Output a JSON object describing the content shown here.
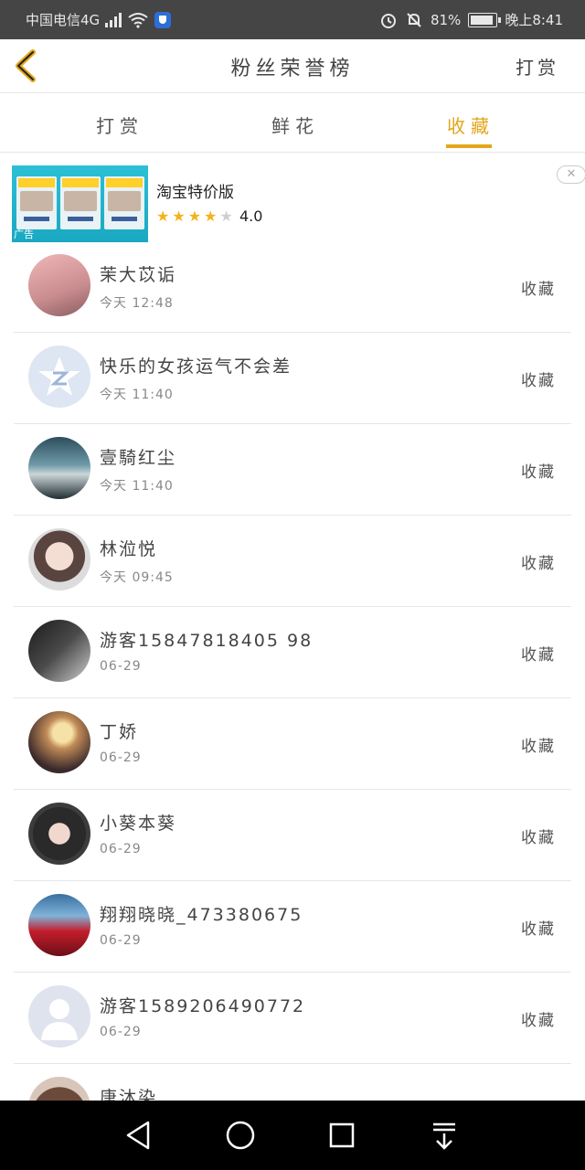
{
  "status_bar": {
    "carrier": "中国电信4G",
    "network": "4G",
    "battery_pct": "81%",
    "battery_fraction": 0.81,
    "time": "晚上8:41"
  },
  "header": {
    "title": "粉丝荣誉榜",
    "action_label": "打赏"
  },
  "tabs": [
    {
      "label": "打赏"
    },
    {
      "label": "鲜花"
    },
    {
      "label": "收藏",
      "active": true
    }
  ],
  "ad": {
    "title": "淘宝特价版",
    "rating": "4.0",
    "stars": 4,
    "tag": "广告",
    "close": "✕"
  },
  "list": [
    {
      "name": "茉大苡诟",
      "time": "今天 12:48",
      "action": "收藏"
    },
    {
      "name": "快乐的女孩运气不会差",
      "time": "今天 11:40",
      "action": "收藏"
    },
    {
      "name": "壹騎红尘",
      "time": "今天 11:40",
      "action": "收藏"
    },
    {
      "name": "林涖悦",
      "time": "今天 09:45",
      "action": "收藏"
    },
    {
      "name": "游客15847818405 98",
      "time": "06-29",
      "action": "收藏"
    },
    {
      "name": "丁娇",
      "time": "06-29",
      "action": "收藏"
    },
    {
      "name": "小葵本葵",
      "time": "06-29",
      "action": "收藏"
    },
    {
      "name": "翔翔晓晓_473380675",
      "time": "06-29",
      "action": "收藏"
    },
    {
      "name": "游客1589206490772",
      "time": "06-29",
      "action": "收藏"
    },
    {
      "name": "唐沐染",
      "time": "",
      "action": ""
    }
  ],
  "colors": {
    "accent": "#e3a51a",
    "status_bar": "#454545",
    "nav_bar": "#000000"
  }
}
